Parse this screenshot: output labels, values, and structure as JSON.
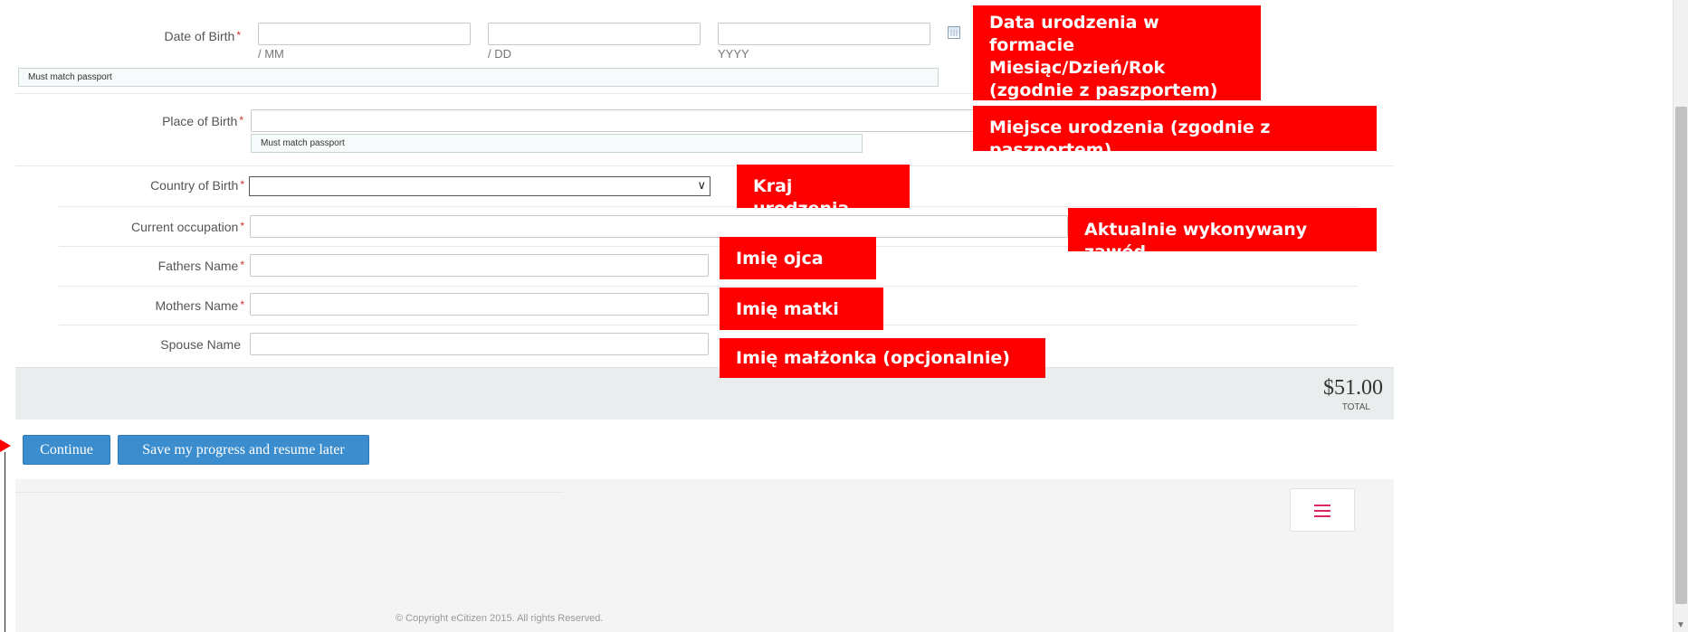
{
  "form": {
    "date_of_birth": {
      "label": "Date of Birth",
      "required": "*",
      "month_hint": "/ MM",
      "day_hint": "/ DD",
      "year_hint": "YYYY",
      "month_value": "",
      "day_value": "",
      "year_value": "",
      "note": "Must match passport"
    },
    "place_of_birth": {
      "label": "Place of Birth",
      "required": "*",
      "value": "",
      "note": "Must match passport"
    },
    "country_of_birth": {
      "label": "Country of Birth",
      "required": "*",
      "selected": ""
    },
    "current_occupation": {
      "label": "Current occupation",
      "required": "*",
      "value": ""
    },
    "fathers_name": {
      "label": "Fathers Name",
      "required": "*",
      "value": ""
    },
    "mothers_name": {
      "label": "Mothers Name",
      "required": "*",
      "value": ""
    },
    "spouse_name": {
      "label": "Spouse Name",
      "value": ""
    }
  },
  "callouts": {
    "date_of_birth": "Data urodzenia w formacie Miesiąc/Dzień/Rok (zgodnie z paszportem)",
    "place_of_birth": "Miejsce urodzenia (zgodnie z paszportem)",
    "country_of_birth": "Kraj urodzenia",
    "current_occupation": "Aktualnie wykonywany zawód",
    "fathers_name": "Imię ojca",
    "mothers_name": "Imię matki",
    "spouse_name": "Imię małżonka (opcjonalnie)"
  },
  "summary": {
    "total_amount": "$51.00",
    "total_label": "TOTAL"
  },
  "actions": {
    "continue_label": "Continue",
    "save_label": "Save my progress and resume later"
  },
  "footer": {
    "copyright": "© Copyright eCitizen 2015. All rights Reserved."
  },
  "colors": {
    "callout_bg": "#ff0000",
    "button_bg": "#3b8dcd",
    "required_marker": "#c9302c",
    "menu_icon": "#e0245e"
  },
  "icons": {
    "calendar": "calendar-icon",
    "dropdown": "chevron-down-icon",
    "menu": "hamburger-menu-icon"
  }
}
